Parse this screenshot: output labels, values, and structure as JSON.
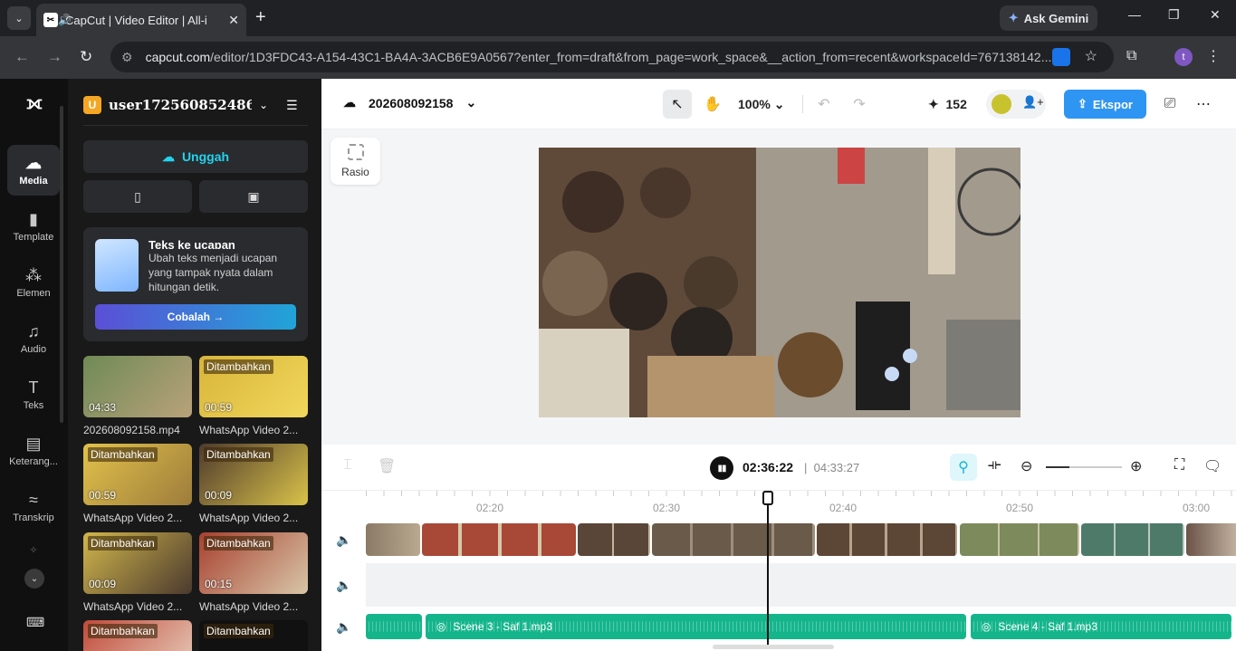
{
  "browser": {
    "tab_title": "CapCut | Video Editor | All-i",
    "url_host": "capcut.com",
    "url_rest": "/editor/1D3FDC43-A154-43C1-BA4A-3ACB6E9A0567?enter_from=draft&from_page=work_space&__action_from=recent&workspaceId=767138142...",
    "gemini_label": "Ask Gemini",
    "profile_initial": "t"
  },
  "rail": {
    "items": [
      {
        "label": "Media",
        "icon": "☁"
      },
      {
        "label": "Template",
        "icon": "▮"
      },
      {
        "label": "Elemen",
        "icon": "⁂"
      },
      {
        "label": "Audio",
        "icon": "♫"
      },
      {
        "label": "Teks",
        "icon": "T"
      },
      {
        "label": "Keterang...",
        "icon": "▤"
      },
      {
        "label": "Transkrip",
        "icon": "≈"
      }
    ]
  },
  "panel": {
    "workspace_initial": "U",
    "workspace_name": "user1725608524861’...",
    "upload_label": "Unggah",
    "tts": {
      "title": "Teks ke ucapan",
      "desc": "Ubah teks menjadi ucapan yang tampak nyata dalam hitungan detik.",
      "button": "Cobalah"
    },
    "media": [
      {
        "badge": "",
        "duration": "04:33",
        "name": "202608092158.mp4",
        "color1": "#6f8a56",
        "color2": "#b9a27a"
      },
      {
        "badge": "Ditambahkan",
        "duration": "00:59",
        "name": "WhatsApp Video 2...",
        "color1": "#d8b53a",
        "color2": "#f1d75c"
      },
      {
        "badge": "Ditambahkan",
        "duration": "00:59",
        "name": "WhatsApp Video 2...",
        "color1": "#e2c24a",
        "color2": "#9d7c3c"
      },
      {
        "badge": "Ditambahkan",
        "duration": "00:09",
        "name": "WhatsApp Video 2...",
        "color1": "#4f3a2d",
        "color2": "#d9c34a"
      },
      {
        "badge": "Ditambahkan",
        "duration": "00:09",
        "name": "WhatsApp Video 2...",
        "color1": "#d1b64c",
        "color2": "#4b3a2e"
      },
      {
        "badge": "Ditambahkan",
        "duration": "00:15",
        "name": "WhatsApp Video 2...",
        "color1": "#a8402f",
        "color2": "#d8c6a8"
      },
      {
        "badge": "Ditambahkan",
        "duration": "",
        "name": "",
        "color1": "#c14a3a",
        "color2": "#e9d4c2"
      },
      {
        "badge": "Ditambahkan",
        "duration": "",
        "name": "",
        "color1": "#111111",
        "color2": "#111111"
      }
    ]
  },
  "editor": {
    "project_name": "202608092158",
    "zoom": "100%",
    "credits": "152",
    "export_label": "Ekspor",
    "ratio_label": "Rasio",
    "current_time": "02:36:22",
    "total_time": "04:33:27",
    "ruler_ticks": [
      "02:20",
      "02:30",
      "02:40",
      "02:50",
      "03:00"
    ],
    "audio_clips": [
      "Scene 3 - Saf 1.mp3",
      "Scene 4 - Saf 1.mp3"
    ]
  }
}
